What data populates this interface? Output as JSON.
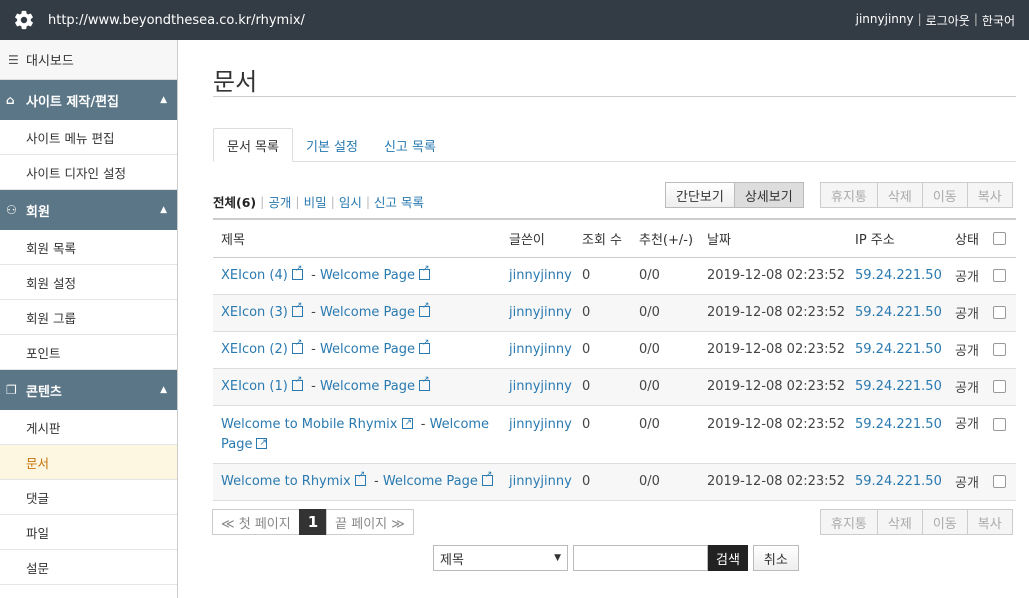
{
  "topbar": {
    "url": "http://www.beyondthesea.co.kr/rhymix/",
    "user": "jinnyjinny",
    "logout": "로그아웃",
    "language": "한국어"
  },
  "sidebar": {
    "dashboard": "대시보드",
    "groups": [
      {
        "label": "사이트 제작/편집",
        "items": [
          "사이트 메뉴 편집",
          "사이트 디자인 설정"
        ]
      },
      {
        "label": "회원",
        "items": [
          "회원 목록",
          "회원 설정",
          "회원 그룹",
          "포인트"
        ]
      },
      {
        "label": "콘텐츠",
        "items": [
          "게시판",
          "문서",
          "댓글",
          "파일",
          "설문"
        ]
      }
    ],
    "active_item": "문서"
  },
  "page": {
    "title": "문서",
    "tabs": [
      "문서 목록",
      "기본 설정",
      "신고 목록"
    ],
    "filter": {
      "all": "전체(6)",
      "public": "공개",
      "secret": "비밀",
      "temp": "임시",
      "reported": "신고 목록"
    },
    "view_buttons": [
      "간단보기",
      "상세보기"
    ],
    "action_buttons": [
      "휴지통",
      "삭제",
      "이동",
      "복사"
    ]
  },
  "table": {
    "headers": [
      "제목",
      "글쓴이",
      "조회 수",
      "추천(+/-)",
      "날짜",
      "IP 주소",
      "상태"
    ],
    "rows": [
      {
        "title": "XEIcon (4)",
        "category": "Welcome Page",
        "author": "jinnyjinny",
        "views": "0",
        "votes": "0/0",
        "date": "2019-12-08 02:23:52",
        "ip": "59.24.221.50",
        "status": "공개"
      },
      {
        "title": "XEIcon (3)",
        "category": "Welcome Page",
        "author": "jinnyjinny",
        "views": "0",
        "votes": "0/0",
        "date": "2019-12-08 02:23:52",
        "ip": "59.24.221.50",
        "status": "공개"
      },
      {
        "title": "XEIcon (2)",
        "category": "Welcome Page",
        "author": "jinnyjinny",
        "views": "0",
        "votes": "0/0",
        "date": "2019-12-08 02:23:52",
        "ip": "59.24.221.50",
        "status": "공개"
      },
      {
        "title": "XEIcon (1)",
        "category": "Welcome Page",
        "author": "jinnyjinny",
        "views": "0",
        "votes": "0/0",
        "date": "2019-12-08 02:23:52",
        "ip": "59.24.221.50",
        "status": "공개"
      },
      {
        "title": "Welcome to Mobile Rhymix",
        "category": "Welcome Page",
        "author": "jinnyjinny",
        "views": "0",
        "votes": "0/0",
        "date": "2019-12-08 02:23:52",
        "ip": "59.24.221.50",
        "status": "공개"
      },
      {
        "title": "Welcome to Rhymix",
        "category": "Welcome Page",
        "author": "jinnyjinny",
        "views": "0",
        "votes": "0/0",
        "date": "2019-12-08 02:23:52",
        "ip": "59.24.221.50",
        "status": "공개"
      }
    ]
  },
  "pagination": {
    "first": "≪ 첫 페이지",
    "current": "1",
    "last": "끝 페이지 ≫"
  },
  "search": {
    "field": "제목",
    "search_label": "검색",
    "cancel_label": "취소"
  }
}
